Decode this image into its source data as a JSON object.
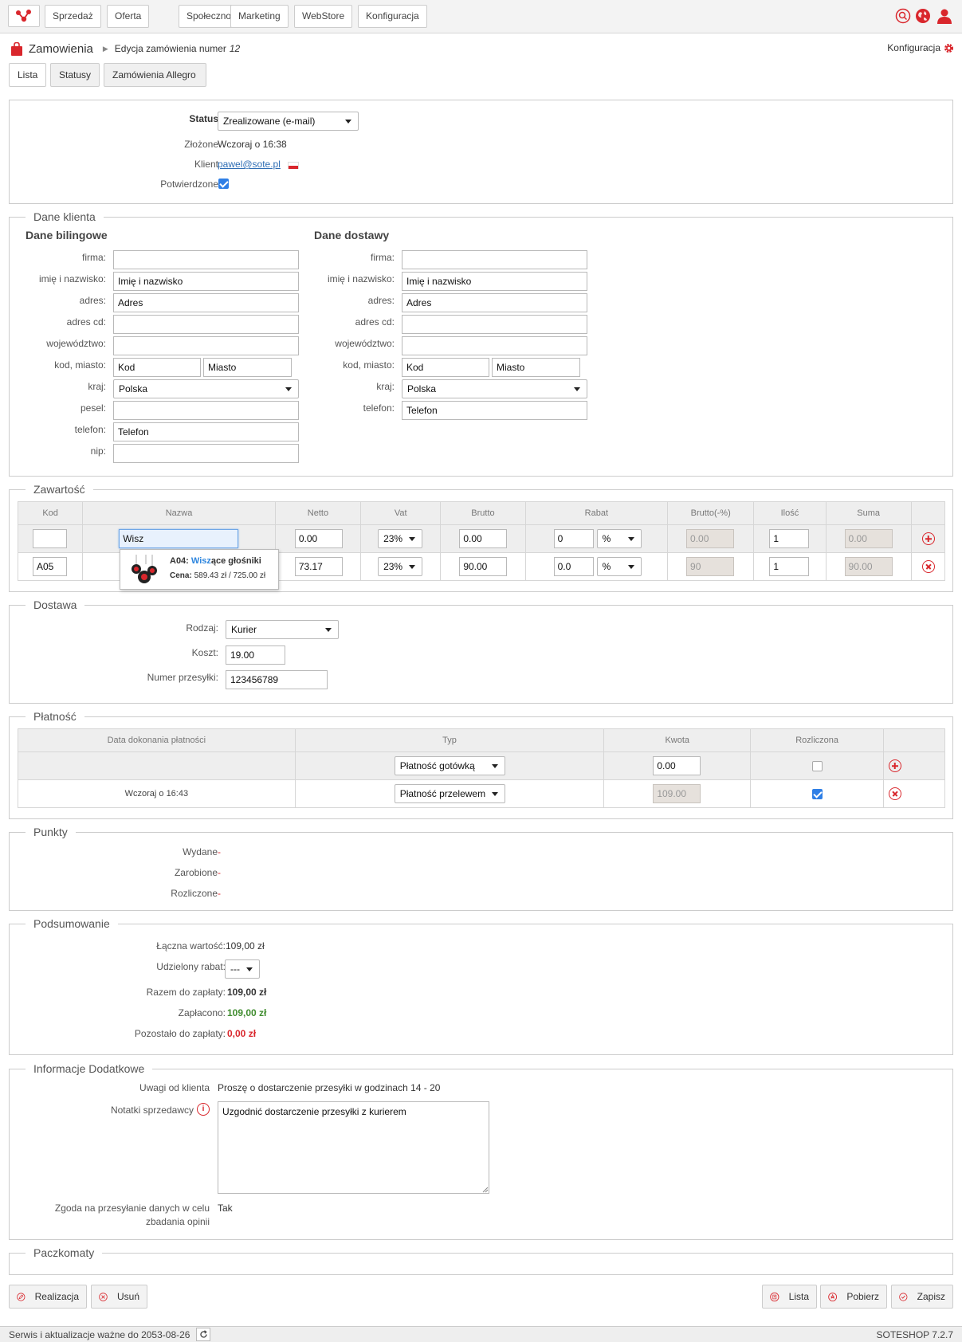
{
  "nav": {
    "items": [
      "Sprzedaż",
      "Oferta",
      "Społeczność",
      "Marketing",
      "WebStore",
      "Konfiguracja"
    ],
    "icons": [
      "search-icon",
      "globe-icon",
      "user-icon"
    ]
  },
  "breadcrumb": {
    "title": "Zamowienia",
    "sub": "Edycja zamówienia numer",
    "num": "12",
    "config": "Konfiguracja"
  },
  "tabs": [
    "Lista",
    "Statusy",
    "Zamówienia Allegro"
  ],
  "order": {
    "status_label": "Status",
    "status_value": "Zrealizowane (e-mail)",
    "placed_label": "Złożone",
    "placed_value": "Wczoraj o 16:38",
    "client_label": "Klient",
    "client_value": "pawel@sote.pl",
    "confirmed_label": "Potwierdzone"
  },
  "client": {
    "legend": "Dane klienta",
    "billing": {
      "title": "Dane bilingowe",
      "company_label": "firma:",
      "company": "",
      "name_label": "imię i nazwisko:",
      "name": "Imię i nazwisko",
      "address_label": "adres:",
      "address": "Adres",
      "address2_label": "adres cd:",
      "address2": "",
      "region_label": "województwo:",
      "region": "",
      "zip_label": "kod, miasto:",
      "zip": "Kod",
      "city": "Miasto",
      "country_label": "kraj:",
      "country": "Polska",
      "pesel_label": "pesel:",
      "pesel": "",
      "phone_label": "telefon:",
      "phone": "Telefon",
      "nip_label": "nip:",
      "nip": ""
    },
    "shipping": {
      "title": "Dane dostawy",
      "company_label": "firma:",
      "company": "",
      "name_label": "imię i nazwisko:",
      "name": "Imię i nazwisko",
      "address_label": "adres:",
      "address": "Adres",
      "address2_label": "adres cd:",
      "address2": "",
      "region_label": "województwo:",
      "region": "",
      "zip_label": "kod, miasto:",
      "zip": "Kod",
      "city": "Miasto",
      "country_label": "kraj:",
      "country": "Polska",
      "phone_label": "telefon:",
      "phone": "Telefon"
    }
  },
  "content": {
    "legend": "Zawartość",
    "headers": [
      "Kod",
      "Nazwa",
      "Netto",
      "Vat",
      "Brutto",
      "Rabat",
      "Brutto(-%)",
      "Ilość",
      "Suma"
    ],
    "new_row": {
      "code": "",
      "name": "Wisz",
      "net": "0.00",
      "vat": "23%",
      "gross": "0.00",
      "discount": "0",
      "discount_type": "%",
      "gross_disc": "0.00",
      "qty": "1",
      "sum": "0.00"
    },
    "row": {
      "code": "A05",
      "net": "73.17",
      "vat": "23%",
      "gross": "90.00",
      "discount": "0.0",
      "discount_type": "%",
      "gross_disc": "90",
      "qty": "1",
      "sum": "90.00"
    },
    "suggest": {
      "code": "A04:",
      "name_match": "Wisz",
      "name_rest": "ące głośniki",
      "price_label": "Cena:",
      "price": "589.43 zł / 725.00 zł"
    }
  },
  "delivery": {
    "legend": "Dostawa",
    "type_label": "Rodzaj:",
    "type": "Kurier",
    "cost_label": "Koszt:",
    "cost": "19.00",
    "tracking_label": "Numer przesyłki:",
    "tracking": "123456789"
  },
  "payment": {
    "legend": "Płatność",
    "headers": [
      "Data dokonania płatności",
      "Typ",
      "Kwota",
      "Rozliczona"
    ],
    "new_row": {
      "date": "",
      "type": "Płatność gotówką",
      "amount": "0.00"
    },
    "row": {
      "date": "Wczoraj o 16:43",
      "type": "Płatność przelewem",
      "amount": "109.00"
    }
  },
  "points": {
    "legend": "Punkty",
    "spent_label": "Wydane",
    "spent": "-",
    "earned_label": "Zarobione",
    "earned": "-",
    "settled_label": "Rozliczone",
    "settled": "-"
  },
  "summary": {
    "legend": "Podsumowanie",
    "total_label": "Łączna wartość:",
    "total": "109,00 zł",
    "discount_label": "Udzielony rabat:",
    "discount": "---",
    "to_pay_label": "Razem do zapłaty:",
    "to_pay": "109,00 zł",
    "paid_label": "Zapłacono:",
    "paid": "109,00 zł",
    "remaining_label": "Pozostało do zapłaty:",
    "remaining": "0,00 zł"
  },
  "extra": {
    "legend": "Informacje Dodatkowe",
    "client_notes_label": "Uwagi od klienta",
    "client_notes": "Proszę o dostarczenie przesyłki w godzinach 14 - 20",
    "seller_notes_label": "Notatki sprzedawcy",
    "seller_notes": "Uzgodnić dostarczenie przesyłki z kurierem",
    "consent_label_1": "Zgoda na przesyłanie danych w celu",
    "consent_label_2": "zbadania opinii",
    "consent": "Tak"
  },
  "parcel": {
    "legend": "Paczkomaty"
  },
  "actions": {
    "realize": "Realizacja",
    "delete": "Usuń",
    "list": "Lista",
    "download": "Pobierz",
    "save": "Zapisz"
  },
  "footer": {
    "service": "Serwis i aktualizacje ważne do 2053-08-26",
    "version": "SOTESHOP 7.2.7"
  },
  "colors": {
    "accent": "#d9262c",
    "link": "#2e6db4",
    "paid": "#3f8c2e"
  }
}
